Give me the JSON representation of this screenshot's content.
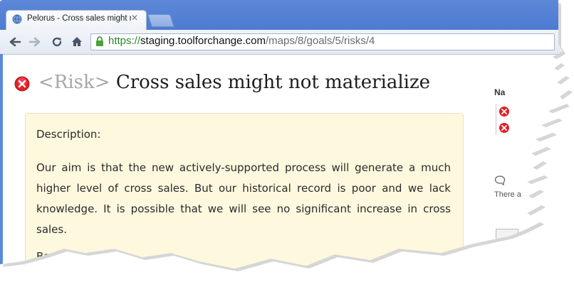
{
  "browser": {
    "tab_title": "Pelorus - Cross sales might nc",
    "url": {
      "scheme": "https://",
      "host": "staging.toolforchange.com",
      "path": "/maps/8/goals/5/risks/4"
    }
  },
  "page": {
    "heading_kind": "<Risk>",
    "heading_title": "Cross sales might not materialize",
    "description_label": "Description:",
    "description_text": "Our aim is that the new actively-supported process will generate a much higher level of cross sales. But our historical record is poor and we lack knowledge. It is possible that we will see no significant increase in cross sales.",
    "baseline_label": "Base"
  },
  "sidebar": {
    "heading": "Na",
    "comment_text": "There a"
  },
  "colors": {
    "tab_strip": "#5d88d8",
    "description_background": "#fdf8de",
    "risk_icon": "#e0202a",
    "url_scheme": "#2c8a2c"
  },
  "icons": [
    "globe-favicon-icon",
    "close-icon",
    "back-arrow-icon",
    "forward-arrow-icon",
    "reload-icon",
    "home-icon",
    "lock-icon",
    "risk-x-icon",
    "comment-icon"
  ]
}
